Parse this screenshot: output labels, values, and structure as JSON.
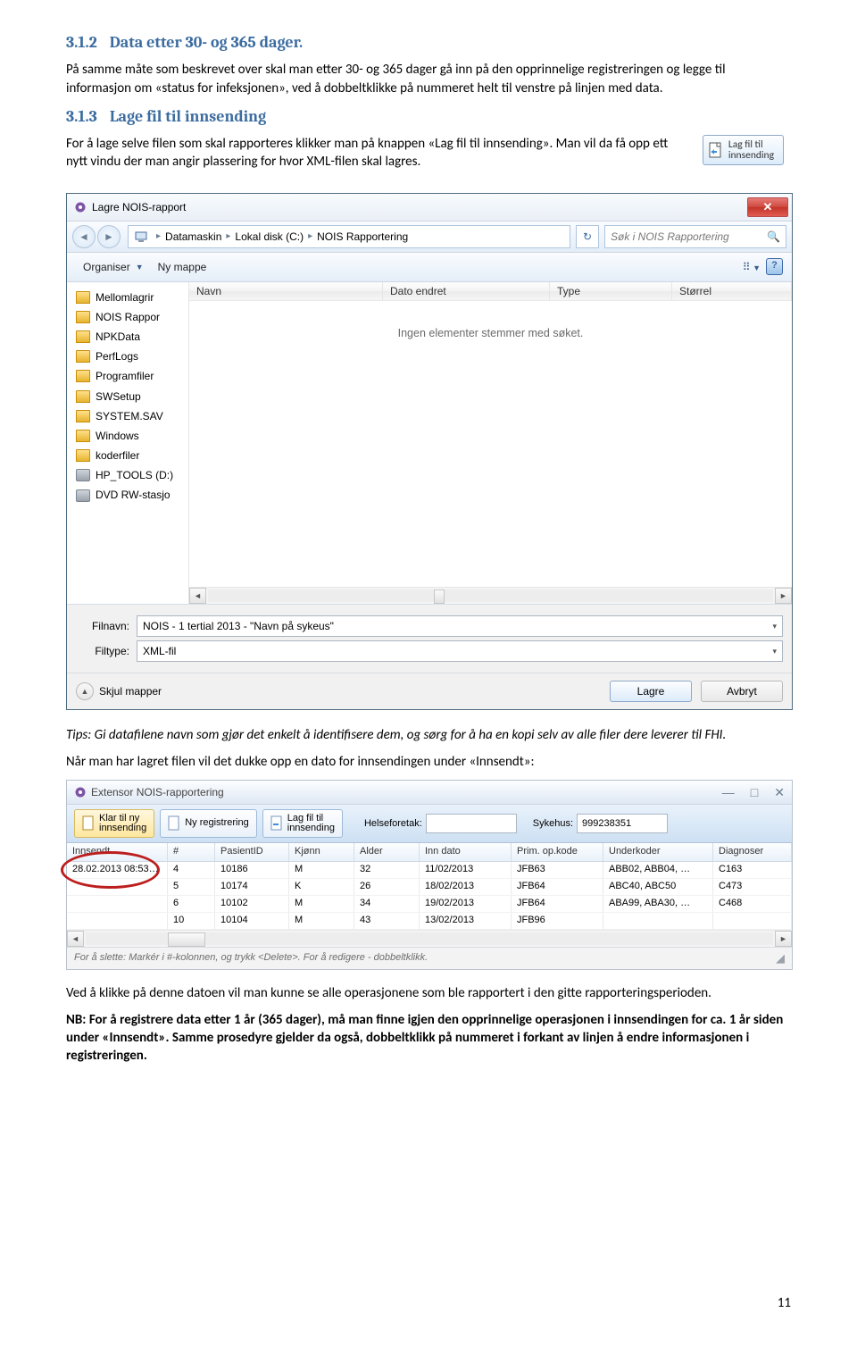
{
  "heading312_num": "3.1.2",
  "heading312_txt": "Data etter 30- og 365 dager.",
  "p312": "På samme måte som beskrevet over skal man etter 30- og 365 dager gå inn på den opprinnelige registreringen og legge til informasjon om «status for infeksjonen», ved å dobbeltklikke på nummeret helt til venstre på linjen med data.",
  "heading313_num": "3.1.3",
  "heading313_txt": "Lage fil til innsending",
  "p313": "For å lage selve filen som skal rapporteres klikker man på knappen «Lag fil til innsending». Man vil da få opp ett nytt vindu der man angir plassering for hvor XML-filen skal lagres.",
  "lagbtn": "Lag fil til\ninnsending",
  "dlg": {
    "title": "Lagre NOIS-rapport",
    "crumbs": [
      "Datamaskin",
      "Lokal disk (C:)",
      "NOIS Rapportering"
    ],
    "search": "Søk i NOIS Rapportering",
    "organiser": "Organiser",
    "nymappe": "Ny mappe",
    "side": [
      "Mellomlagrir",
      "NOIS Rappor",
      "NPKData",
      "PerfLogs",
      "Programfiler",
      "SWSetup",
      "SYSTEM.SAV",
      "Windows",
      "koderfiler",
      "HP_TOOLS (D:)",
      "DVD RW-stasjo"
    ],
    "cols": {
      "navn": "Navn",
      "dato": "Dato endret",
      "type": "Type",
      "storrel": "Størrel"
    },
    "empty": "Ingen elementer stemmer med søket.",
    "filnavn_l": "Filnavn:",
    "filnavn_v": "NOIS - 1 tertial 2013 - \"Navn på sykeus\"",
    "filtype_l": "Filtype:",
    "filtype_v": "XML-fil",
    "skjul": "Skjul mapper",
    "lagre": "Lagre",
    "avbryt": "Avbryt"
  },
  "tips": "Tips: Gi datafilene navn som gjør det enkelt å identifisere dem, og sørg for å ha en kopi selv av alle filer dere leverer til FHI.",
  "p_when": "Når man har lagret filen vil det dukke opp en dato for innsendingen under «Innsendt»:",
  "ext": {
    "title": "Extensor NOIS-rapportering",
    "klarbtn": "Klar til ny\ninnsending",
    "nyreg": "Ny registrering",
    "lag": "Lag fil til\ninnsending",
    "helsef_l": "Helseforetak:",
    "helsef_v": "",
    "syk_l": "Sykehus:",
    "syk_v": "999238351",
    "cols": [
      "Innsendt",
      "#",
      "PasientID",
      "Kjønn",
      "Alder",
      "Inn dato",
      "Prim. op.kode",
      "Underkoder",
      "Diagnoser"
    ],
    "rows": [
      [
        "28.02.2013 08:53…",
        "4",
        "10186",
        "M",
        "32",
        "11/02/2013",
        "JFB63",
        "ABB02, ABB04, …",
        "C163"
      ],
      [
        "",
        "5",
        "10174",
        "K",
        "26",
        "18/02/2013",
        "JFB64",
        "ABC40, ABC50",
        "C473"
      ],
      [
        "",
        "6",
        "10102",
        "M",
        "34",
        "19/02/2013",
        "JFB64",
        "ABA99, ABA30, …",
        "C468"
      ],
      [
        "",
        "10",
        "10104",
        "M",
        "43",
        "13/02/2013",
        "JFB96",
        "",
        ""
      ]
    ],
    "status": "For å slette: Markér i #-kolonnen, og trykk <Delete>. For å redigere - dobbeltklikk."
  },
  "p_click": "Ved å klikke på denne datoen vil man kunne se alle operasjonene som ble rapportert i den gitte rapporteringsperioden.",
  "p_nb": "NB: For å registrere data etter 1 år (365 dager), må man finne igjen den opprinnelige operasjonen i innsendingen for ca. 1 år siden under «Innsendt». Samme prosedyre gjelder da også, dobbeltklikk på nummeret i forkant av linjen å endre informasjonen i registreringen.",
  "pagenum": "11"
}
